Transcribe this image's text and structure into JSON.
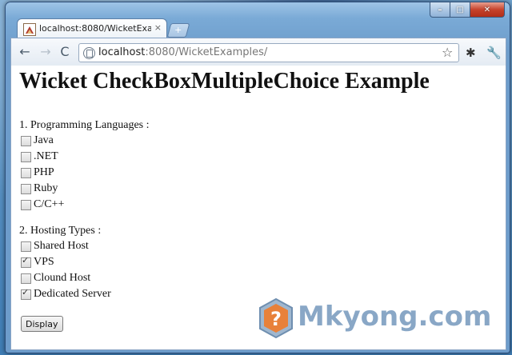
{
  "browser": {
    "tab": {
      "title": "localhost:8080/WicketExa...",
      "close": "×"
    },
    "new_tab": "+",
    "window_controls": {
      "minimize": "–",
      "maximize": "□",
      "close": "✕"
    },
    "toolbar": {
      "back": "←",
      "forward": "→",
      "reload": "C",
      "url_host": "localhost",
      "url_rest": ":8080/WicketExamples/",
      "star": "☆",
      "extension": "✱",
      "wrench": "🔧"
    }
  },
  "page": {
    "title": "Wicket CheckBoxMultipleChoice Example",
    "languages": {
      "label": "1. Programming Languages :",
      "options": [
        {
          "label": "Java",
          "checked": false
        },
        {
          "label": ".NET",
          "checked": false
        },
        {
          "label": "PHP",
          "checked": false
        },
        {
          "label": "Ruby",
          "checked": false
        },
        {
          "label": "C/C++",
          "checked": false
        }
      ]
    },
    "hosting": {
      "label": "2. Hosting Types :",
      "options": [
        {
          "label": "Shared Host",
          "checked": false
        },
        {
          "label": "VPS",
          "checked": true
        },
        {
          "label": "Clound Host",
          "checked": false
        },
        {
          "label": "Dedicated Server",
          "checked": true
        }
      ]
    },
    "display_button": "Display"
  },
  "watermark": {
    "text": "Mkyong.com"
  },
  "colors": {
    "watermark": "#7598bd",
    "window_frame": "#6d9ccb",
    "close_button": "#c6432c"
  }
}
